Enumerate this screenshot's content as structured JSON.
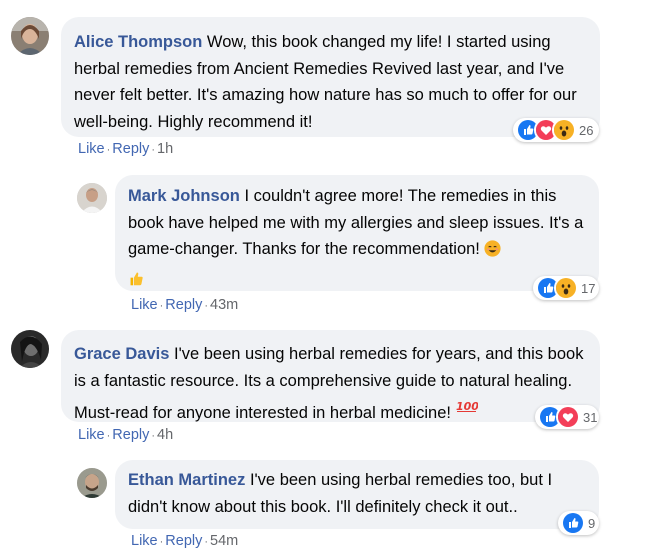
{
  "comments": [
    {
      "author": "Alice Thompson",
      "text": " Wow, this book changed my life! I started using herbal remedies from Ancient Remedies Revived last year, and I've never felt better. It's amazing how nature has so much to offer for our well-being. Highly recommend it!",
      "like_label": "Like",
      "reply_label": "Reply",
      "time": "1h",
      "reaction_count": "26",
      "reaction_icons": [
        "like-icon",
        "love-icon",
        "wow-icon"
      ]
    },
    {
      "author": "Mark Johnson",
      "text": " I couldn't agree more! The remedies in this book have helped me with my allergies and sleep issues. It's a game-changer. Thanks for the recommendation! ",
      "like_label": "Like",
      "reply_label": "Reply",
      "time": "43m",
      "reaction_count": "17",
      "reaction_icons": [
        "like-icon",
        "wow-icon"
      ],
      "inline_emoji": [
        "smile-emoji",
        "thumbs-up-emoji"
      ]
    },
    {
      "author": "Grace Davis",
      "text": " I've been using herbal remedies for years, and this book is a fantastic resource. Its a comprehensive guide to natural healing. Must-read for anyone interested in herbal medicine! ",
      "like_label": "Like",
      "reply_label": "Reply",
      "time": "4h",
      "reaction_count": "31",
      "reaction_icons": [
        "like-icon",
        "love-icon"
      ],
      "inline_emoji": [
        "hundred-emoji"
      ]
    },
    {
      "author": "Ethan Martinez",
      "text": " I've been using herbal remedies too, but I didn't know about this book. I'll definitely check it out..",
      "like_label": "Like",
      "reply_label": "Reply",
      "time": "54m",
      "reaction_count": "9",
      "reaction_icons": [
        "like-icon"
      ]
    }
  ],
  "colors": {
    "bubble": "#f0f2f5",
    "author": "#385898",
    "action_link": "#4267b2",
    "like_blue": "#1877f2",
    "love_red": "#f33e58",
    "wow_yellow": "#f7b125"
  }
}
